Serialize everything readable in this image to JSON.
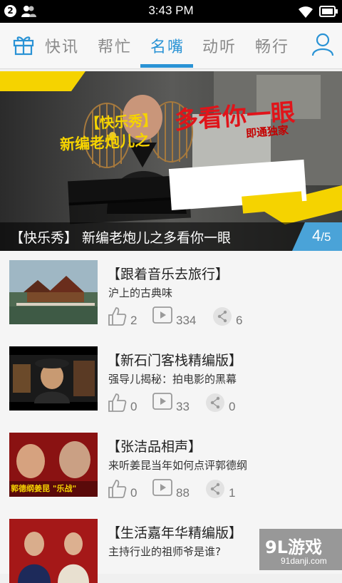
{
  "status_bar": {
    "notification_count": "2",
    "time": "3:43 PM"
  },
  "nav": {
    "tabs": [
      "快讯",
      "帮忙",
      "名嘴",
      "动听",
      "畅行"
    ],
    "active_tab": "名嘴"
  },
  "banner": {
    "headline_tag": "【快乐秀】",
    "headline_line1": "新编老炮儿之",
    "headline_big": "多看你一眼",
    "badge": "即通独家",
    "caption": "【快乐秀】 新编老炮儿之多看你一眼",
    "page_current": "4",
    "page_total": "5"
  },
  "items": [
    {
      "title": "【跟着音乐去旅行】",
      "subtitle": "沪上的古典味",
      "likes": "2",
      "plays": "334",
      "shares": "6"
    },
    {
      "title": "【新石门客栈精编版】",
      "subtitle": "强导儿揭秘：拍电影的黑幕",
      "likes": "0",
      "plays": "33",
      "shares": "0"
    },
    {
      "title": "【张洁品相声】",
      "subtitle": "来听姜昆当年如何点评郭德纲",
      "likes": "0",
      "plays": "88",
      "shares": "1",
      "thumb_text": "郭德纲姜昆 \"乐战\""
    },
    {
      "title": "【生活嘉年华精编版】",
      "subtitle": "主持行业的祖师爷是谁?",
      "likes": "",
      "plays": "",
      "shares": ""
    }
  ],
  "watermark": {
    "brand": "9L游戏",
    "url": "91danji.com"
  },
  "colors": {
    "accent": "#2a93d5",
    "banner_yellow": "#f5d300",
    "banner_red": "#e0141a"
  }
}
